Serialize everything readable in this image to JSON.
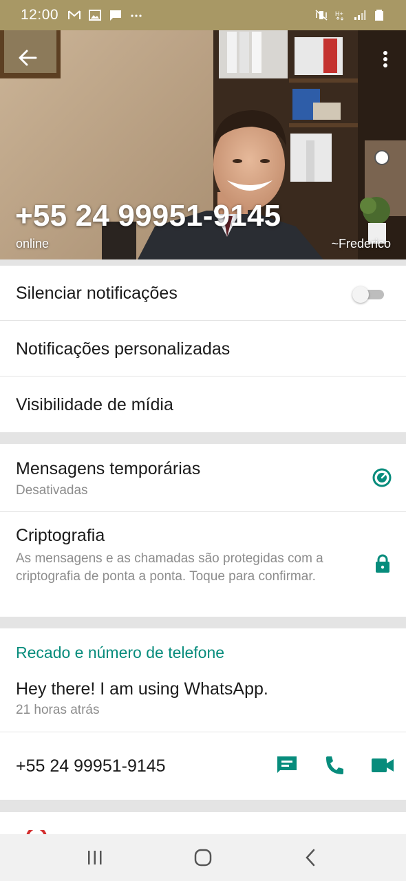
{
  "status_bar": {
    "time": "12:00",
    "left_icons": [
      "gmail-icon",
      "image-icon",
      "message-icon",
      "more-dots-icon"
    ],
    "right_icons": [
      "mute-vibrate-icon",
      "hplus-data-icon",
      "signal-icon",
      "battery-icon"
    ]
  },
  "header": {
    "title": "+55 24 99951-9145",
    "status": "online",
    "push_name": "~Frederico"
  },
  "settings": {
    "mute_label": "Silenciar notificações",
    "mute_enabled": false,
    "custom_notifications_label": "Notificações personalizadas",
    "media_visibility_label": "Visibilidade de mídia"
  },
  "privacy": {
    "disappearing_title": "Mensagens temporárias",
    "disappearing_status": "Desativadas",
    "encryption_title": "Criptografia",
    "encryption_desc": "As mensagens e as chamadas são protegidas com a criptografia de ponta a ponta. Toque para confirmar."
  },
  "about": {
    "section_title": "Recado e número de telefone",
    "about_text": "Hey there! I am using WhatsApp.",
    "about_time": "21 horas atrás",
    "phone": "+55 24 99951-9145"
  },
  "colors": {
    "accent": "#078c7c",
    "status_bar": "#a89865"
  }
}
